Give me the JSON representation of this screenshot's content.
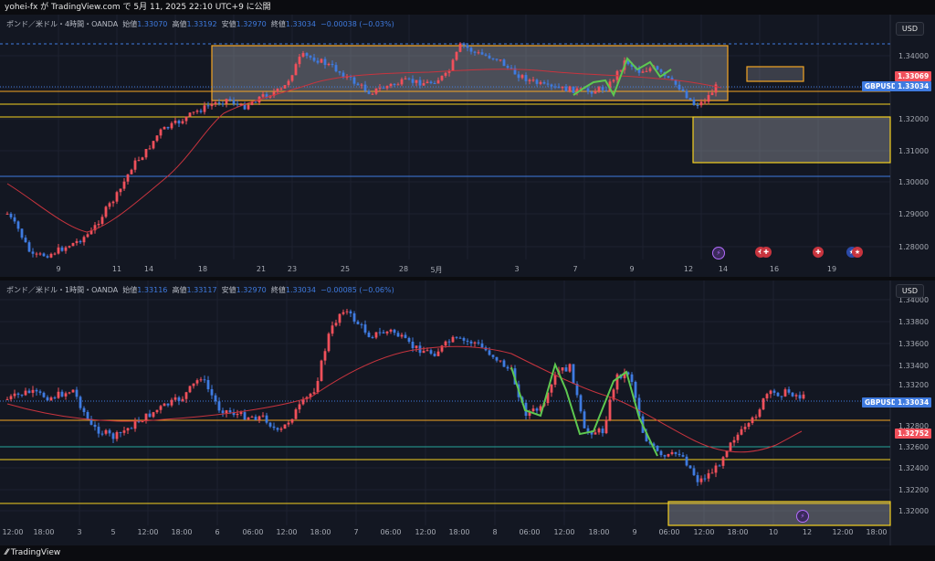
{
  "header": {
    "text": "yohei-fx が TradingView.com で 5月 11, 2025 22:10 UTC+9 に公開"
  },
  "footer": {
    "logo_text": "TradingView"
  },
  "panel1": {
    "info": {
      "symbol": "ポンド／米ドル・4時間・OANDA",
      "open_label": "始値",
      "open": "1.33070",
      "high_label": "高値",
      "high": "1.33192",
      "low_label": "安値",
      "low": "1.32970",
      "close_label": "終値",
      "close": "1.33034",
      "change": "−0.00038 (−0.03%)"
    },
    "currency": "USD",
    "price_labels": [
      "1.34000",
      "1.32000",
      "1.31000",
      "1.30000",
      "1.29000",
      "1.28000"
    ],
    "x_labels": [
      "9",
      "11",
      "14",
      "18",
      "21",
      "23",
      "25",
      "28",
      "5月",
      "3",
      "7",
      "9",
      "12",
      "14",
      "16",
      "19"
    ],
    "tag_red": "1.33069",
    "tag_sym": "GBPUSD",
    "tag_blue": "1.33034",
    "colors": {
      "up": "#f0505b",
      "down": "#3f7be0",
      "zone": "#f5a623",
      "ma": "#c8343e",
      "zigzag": "#5ec850"
    }
  },
  "panel2": {
    "info": {
      "symbol": "ポンド／米ドル・1時間・OANDA",
      "open_label": "始値",
      "open": "1.33116",
      "high_label": "高値",
      "high": "1.33117",
      "low_label": "安値",
      "low": "1.32970",
      "close_label": "終値",
      "close": "1.33034",
      "change": "−0.00085 (−0.06%)"
    },
    "currency": "USD",
    "price_labels": [
      "1.34000",
      "1.33800",
      "1.33600",
      "1.33400",
      "1.33200",
      "1.32800",
      "1.32600",
      "1.32400",
      "1.32200",
      "1.32000"
    ],
    "x_labels": [
      "12:00",
      "18:00",
      "3",
      "5",
      "12:00",
      "18:00",
      "6",
      "06:00",
      "12:00",
      "18:00",
      "7",
      "06:00",
      "12:00",
      "18:00",
      "8",
      "06:00",
      "12:00",
      "18:00",
      "9",
      "06:00",
      "12:00",
      "18:00",
      "10",
      "12",
      "12:00",
      "18:00"
    ],
    "tag_sym": "GBPUSD",
    "tag_blue": "1.33034",
    "tag_red": "1.32752"
  }
}
